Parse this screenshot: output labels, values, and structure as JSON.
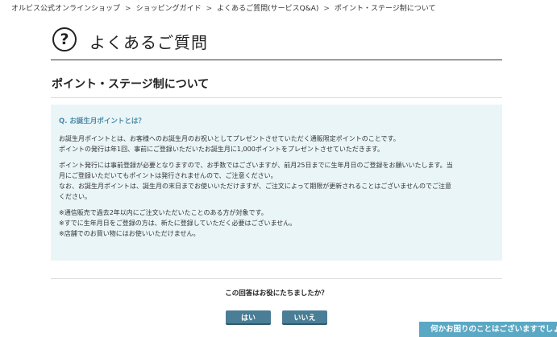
{
  "breadcrumb": {
    "items": [
      "オルビス公式オンラインショップ",
      "ショッピングガイド",
      "よくあるご質問(サービスQ&A)"
    ],
    "current": "ポイント・ステージ制について",
    "separator": ">"
  },
  "header": {
    "icon_glyph": "?",
    "title": "よくあるご質問"
  },
  "section": {
    "title": "ポイント・ステージ制について"
  },
  "faq": {
    "question": "Q. お誕生月ポイントとは？",
    "paragraphs": [
      [
        "お誕生月ポイントとは、お客様へのお誕生月のお祝いとしてプレゼントさせていただく通販限定ポイントのことです。",
        "ポイントの発行は年1回、事前にご登録いただいたお誕生月に1,000ポイントをプレゼントさせていただきます。"
      ],
      [
        "ポイント発行には事前登録が必要となりますので、お手数ではございますが、前月25日までに生年月日のご登録をお願いいたします。当",
        "月にご登録いただいてもポイントは発行されませんので、ご注意ください。",
        "なお、お誕生月ポイントは、誕生月の末日までお使いいただけますが、ご注文によって期限が更新されることはございませんのでご注意",
        "ください。"
      ],
      [
        "※通信販売で過去2年以内にご注文いただいたことのある方が対象です。",
        "※すでに生年月日をご登録の方は、新たに登録していただく必要はございません。",
        "※店舗でのお買い物にはお使いいただけません。"
      ]
    ]
  },
  "feedback": {
    "question": "この回答はお役にたちましたか？",
    "yes_label": "はい",
    "no_label": "いいえ"
  },
  "help_tab": {
    "label": "何かお困りのことはございますでしょうか"
  },
  "colors": {
    "accent": "#4a7d96",
    "faq_background": "#eaf5f7",
    "question_text": "#4d8aa8",
    "help_tab": "#5aa8c4"
  }
}
